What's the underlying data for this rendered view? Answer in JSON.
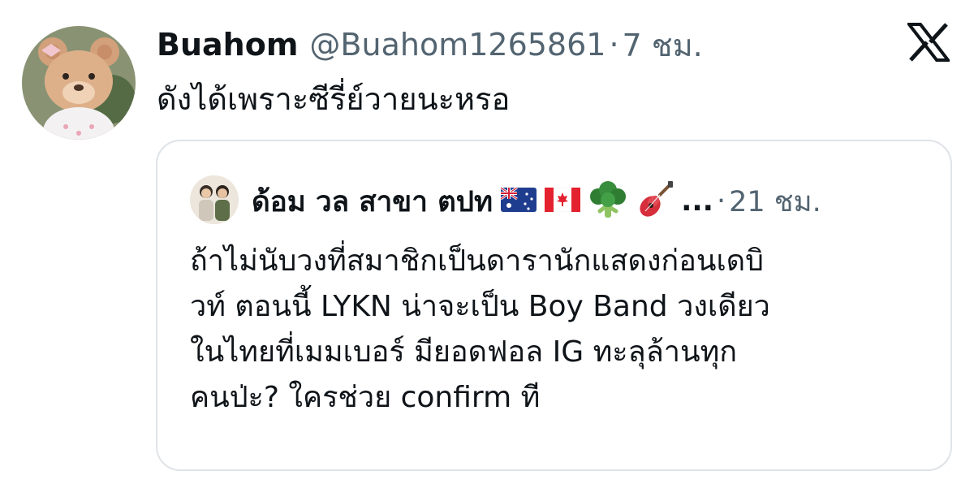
{
  "tweet": {
    "display_name": "Buahom",
    "handle": "@Buahom1265861",
    "separator": "·",
    "time": "7 ชม.",
    "text": "ดังได้เพราะซีรี่ย์วายนะหรอ"
  },
  "quote": {
    "display_name": "ด้อม วล สาขา ตปท",
    "ellipsis": "...",
    "separator": "·",
    "time": "21 ชม.",
    "lines": [
      "ถ้าไม่นับวงที่สมาชิกเป็นดารานักแสดงก่อนเดบิ",
      "วท์ ตอนนี้ LYKN น่าจะเป็น Boy Band วงเดียว",
      "ในไทยที่เมมเบอร์ มียอดฟอล IG ทะลุล้านทุก",
      "คนป่ะ? ใครช่วย confirm ที"
    ],
    "name_icons": [
      "flag-australia-icon",
      "flag-canada-icon",
      "broccoli-icon",
      "guitar-icon"
    ]
  },
  "colors": {
    "text_primary": "#0f1419",
    "text_secondary": "#536471",
    "border": "#dfe3e7"
  },
  "icons": [
    "x-logo-icon",
    "avatar-bear",
    "avatar-two-people"
  ]
}
